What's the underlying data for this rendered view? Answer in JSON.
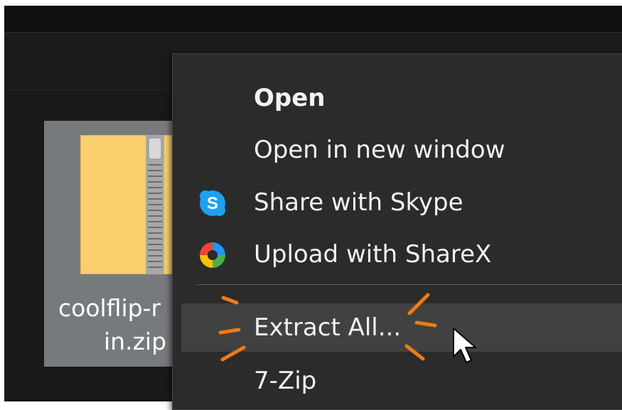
{
  "file": {
    "name_line1": "coolflip-r",
    "name_line2": "in.zip",
    "icon": "zip-folder-icon"
  },
  "context_menu": {
    "items": [
      {
        "label": "Open",
        "icon": null,
        "bold": true
      },
      {
        "label": "Open in new window",
        "icon": null
      },
      {
        "label": "Share with Skype",
        "icon": "skype-icon"
      },
      {
        "label": "Upload with ShareX",
        "icon": "sharex-icon"
      },
      {
        "label": "Extract All...",
        "icon": null,
        "highlighted": true
      },
      {
        "label": "7-Zip",
        "icon": null
      }
    ]
  },
  "colors": {
    "skype": "#1ea1f1",
    "highlight_marks": "#f07a14",
    "menu_background": "#2b2b2b",
    "hover_background": "#414141"
  }
}
